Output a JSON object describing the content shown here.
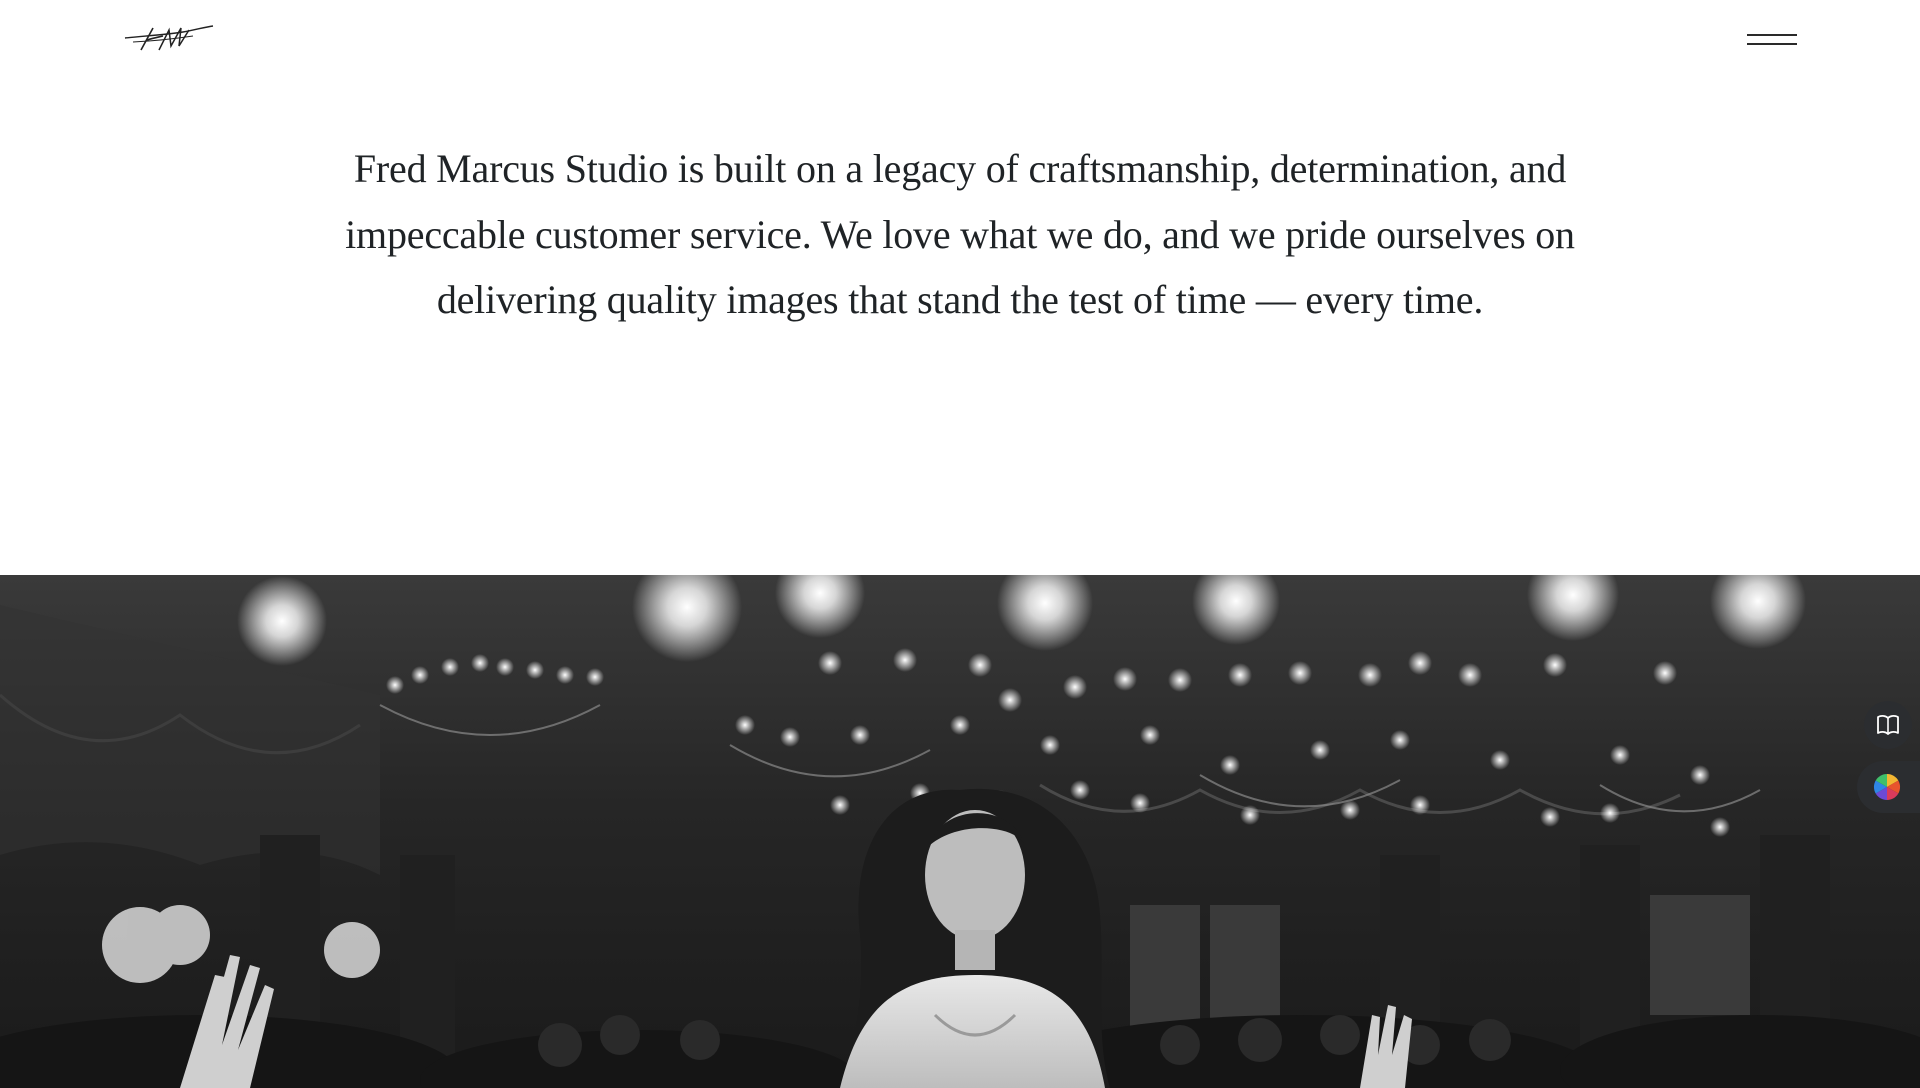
{
  "header": {
    "logo_name": "FM-signature-logo",
    "menu_icon": "hamburger-menu-icon"
  },
  "intro": {
    "text": "Fred Marcus Studio is built on a legacy of craftsmanship, determination, and impeccable customer service. We love what we do, and we pride ourselves on delivering quality images that stand the test of time — every time."
  },
  "hero": {
    "description_icon": "wedding-photo",
    "style": "black-and-white"
  },
  "floating_widgets": {
    "book_icon": "open-book-icon",
    "color_icon": "color-wheel-icon"
  },
  "colors": {
    "text": "#1f2326",
    "background": "#ffffff",
    "widget_bg": "#2b2d30"
  }
}
